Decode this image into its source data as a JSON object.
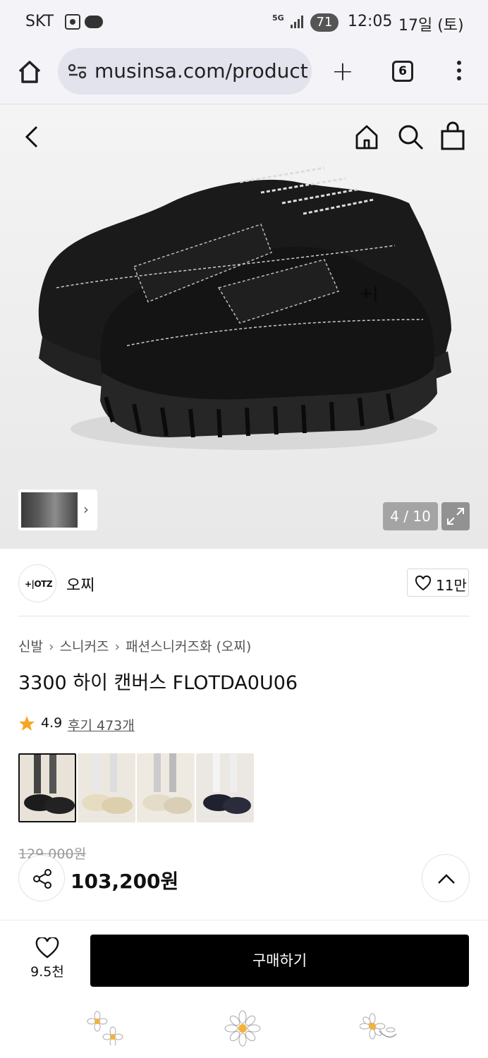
{
  "status_bar": {
    "carrier": "SKT",
    "network": "5G",
    "battery": "71",
    "time": "12:05",
    "date": "17일 (토)"
  },
  "browser": {
    "url": "musinsa.com/product",
    "tab_count": "6"
  },
  "gallery": {
    "counter": "4 / 10"
  },
  "brand": {
    "name": "오찌",
    "logo_text": "+|OTZ",
    "likes": "11만"
  },
  "breadcrumb": [
    "신발",
    "스니커즈",
    "패션스니커즈화 (오찌)"
  ],
  "product": {
    "title": "3300 하이 캔버스 FLOTDA0U06",
    "rating": "4.9",
    "review_label": "후기 473개",
    "original_price": "129,000원",
    "price": "103,200원"
  },
  "bottom": {
    "wish_count": "9.5천",
    "buy_label": "구매하기"
  },
  "colors": {
    "accent_star": "#f5a623",
    "buy_button": "#000000"
  }
}
